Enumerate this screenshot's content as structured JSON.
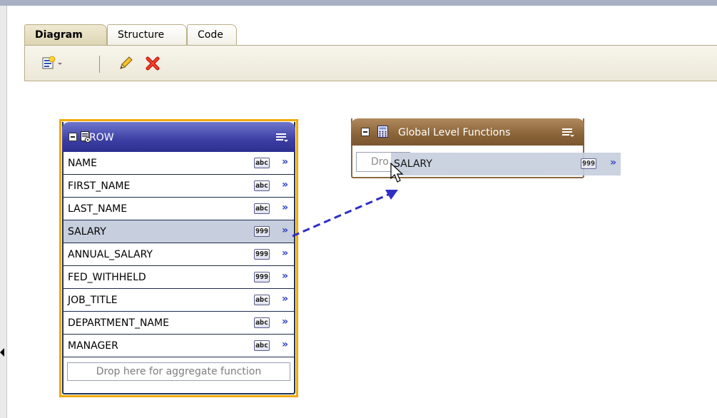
{
  "tabs": [
    {
      "label": "Diagram",
      "active": true
    },
    {
      "label": "Structure",
      "active": false
    },
    {
      "label": "Code",
      "active": false
    }
  ],
  "toolbar": {
    "buttons": [
      {
        "icon": "new-item-dropdown-icon"
      },
      {
        "icon": "pencil-icon"
      },
      {
        "icon": "delete-x-icon"
      }
    ]
  },
  "row_node": {
    "title": "ROW",
    "fields": [
      {
        "name": "NAME",
        "type": "abc",
        "selected": false
      },
      {
        "name": "FIRST_NAME",
        "type": "abc",
        "selected": false
      },
      {
        "name": "LAST_NAME",
        "type": "abc",
        "selected": false
      },
      {
        "name": "SALARY",
        "type": "999",
        "selected": true
      },
      {
        "name": "ANNUAL_SALARY",
        "type": "999",
        "selected": false
      },
      {
        "name": "FED_WITHHELD",
        "type": "999",
        "selected": false
      },
      {
        "name": "JOB_TITLE",
        "type": "abc",
        "selected": false
      },
      {
        "name": "DEPARTMENT_NAME",
        "type": "abc",
        "selected": false
      },
      {
        "name": "MANAGER",
        "type": "abc",
        "selected": false
      }
    ],
    "drop_text": "Drop here for aggregate function",
    "chevron": "»"
  },
  "glf_node": {
    "title": "Global Level Functions",
    "drop_text": "Dro"
  },
  "drag_ghost": {
    "name": "SALARY",
    "type": "999",
    "chevron": "»"
  },
  "colors": {
    "row_header": "#3c3ea3",
    "glf_header": "#8a6438",
    "selection": "#c7cfde",
    "highlight_border": "#f2a900",
    "connector": "#2f2fc8"
  }
}
